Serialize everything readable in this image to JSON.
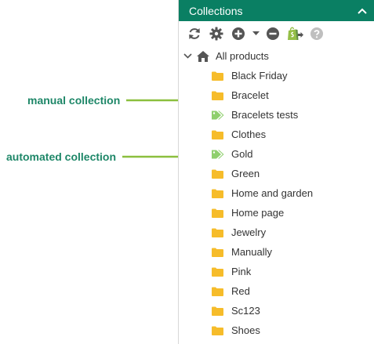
{
  "annotations": {
    "manual": "manual collection",
    "automated": "automated collection",
    "color": "#1e8768",
    "arrow_color": "#8bbf3e"
  },
  "panel": {
    "title": "Collections",
    "header_color": "#0a7f63",
    "toolbar_icons": [
      "refresh-icon",
      "gear-icon",
      "add-icon",
      "dropdown-caret-icon",
      "remove-icon",
      "shopify-export-icon",
      "help-icon"
    ]
  },
  "tree": {
    "root_label": "All products",
    "items": [
      {
        "label": "Black Friday",
        "type": "manual"
      },
      {
        "label": "Bracelet",
        "type": "manual"
      },
      {
        "label": "Bracelets tests",
        "type": "automated"
      },
      {
        "label": "Clothes",
        "type": "manual"
      },
      {
        "label": "Gold",
        "type": "automated"
      },
      {
        "label": "Green",
        "type": "manual"
      },
      {
        "label": "Home and garden",
        "type": "manual"
      },
      {
        "label": "Home page",
        "type": "manual"
      },
      {
        "label": "Jewelry",
        "type": "manual"
      },
      {
        "label": "Manually",
        "type": "manual"
      },
      {
        "label": "Pink",
        "type": "manual"
      },
      {
        "label": "Red",
        "type": "manual"
      },
      {
        "label": "Sc123",
        "type": "manual"
      },
      {
        "label": "Shoes",
        "type": "manual"
      }
    ]
  }
}
